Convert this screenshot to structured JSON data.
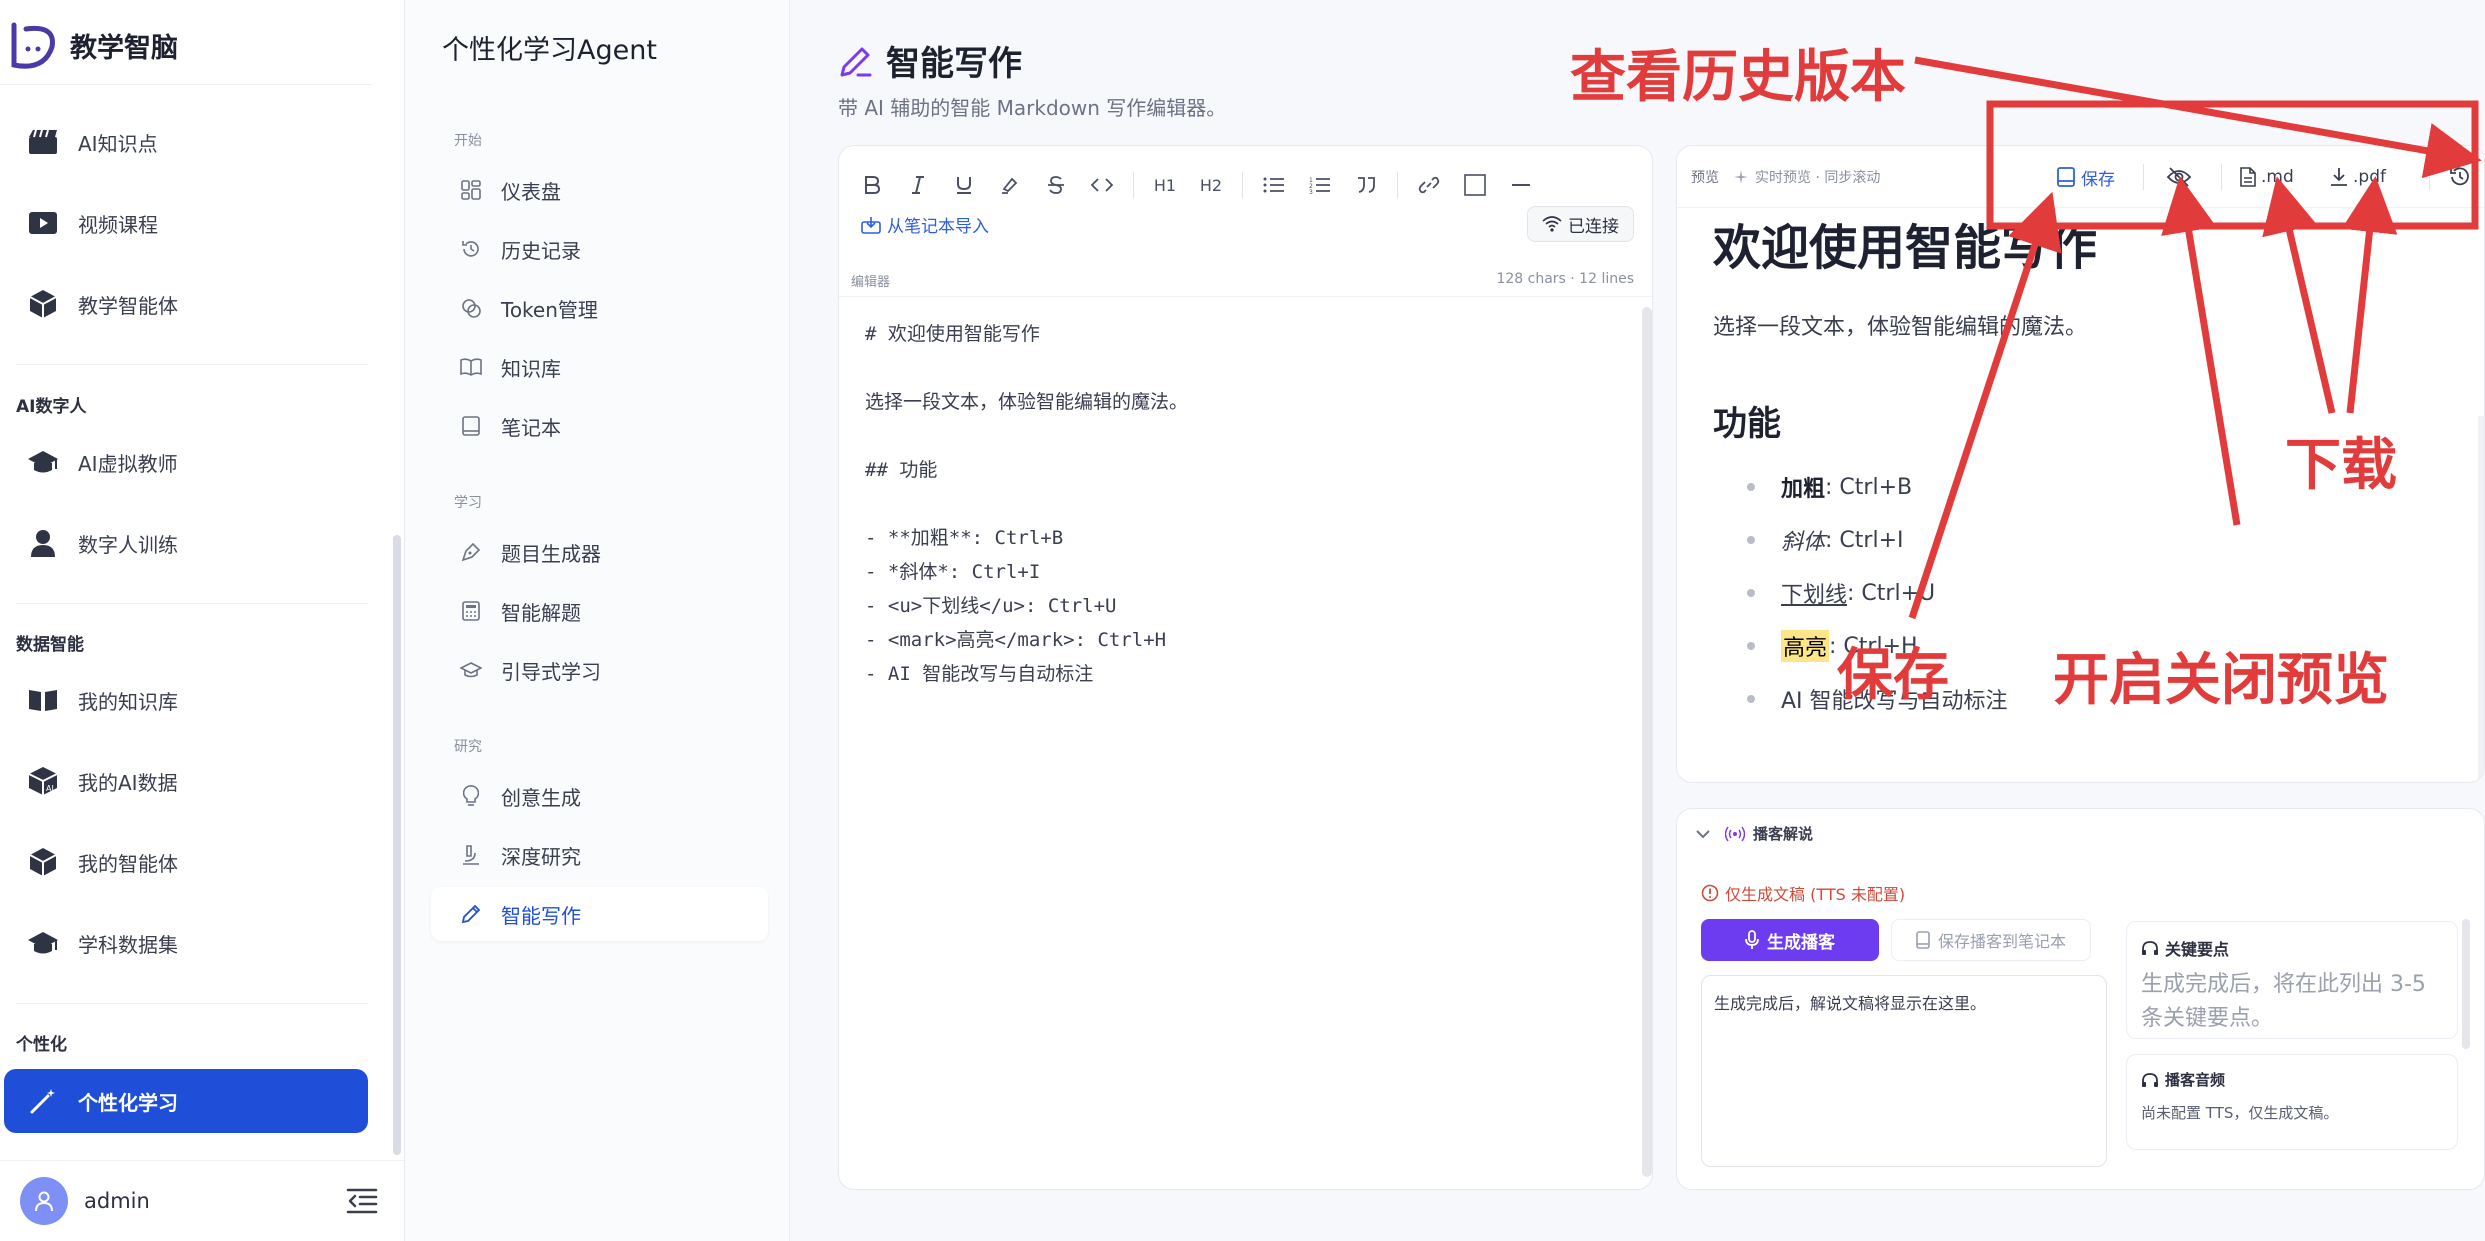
{
  "brand": {
    "name": "教学智脑"
  },
  "sidebar": {
    "items_top": [
      {
        "label": "AI知识点",
        "icon": "clapperboard-icon"
      },
      {
        "label": "视频课程",
        "icon": "video-play-icon"
      },
      {
        "label": "教学智能体",
        "icon": "cube-icon"
      }
    ],
    "group_ai_human": "AI数字人",
    "items_ai_human": [
      {
        "label": "AI虚拟教师",
        "icon": "graduation-cap-icon"
      },
      {
        "label": "数字人训练",
        "icon": "person-icon"
      }
    ],
    "group_data": "数据智能",
    "items_data": [
      {
        "label": "我的知识库",
        "icon": "book-open-icon"
      },
      {
        "label": "我的AI数据",
        "icon": "ai-cube-icon"
      },
      {
        "label": "我的智能体",
        "icon": "cube-icon"
      },
      {
        "label": "学科数据集",
        "icon": "graduation-cap-icon"
      }
    ],
    "group_personal": "个性化",
    "active_item": {
      "label": "个性化学习",
      "icon": "magic-wand-icon"
    },
    "user": {
      "name": "admin"
    }
  },
  "agent_panel": {
    "title": "个性化学习Agent",
    "group_start": "开始",
    "items_start": [
      {
        "label": "仪表盘",
        "icon": "dashboard-icon"
      },
      {
        "label": "历史记录",
        "icon": "history-icon"
      },
      {
        "label": "Token管理",
        "icon": "coins-icon"
      },
      {
        "label": "知识库",
        "icon": "book-icon"
      },
      {
        "label": "笔记本",
        "icon": "notebook-icon"
      }
    ],
    "group_learn": "学习",
    "items_learn": [
      {
        "label": "题目生成器",
        "icon": "pen-tool-icon"
      },
      {
        "label": "智能解题",
        "icon": "calculator-icon"
      },
      {
        "label": "引导式学习",
        "icon": "graduation-cap-icon"
      }
    ],
    "group_research": "研究",
    "items_research": [
      {
        "label": "创意生成",
        "icon": "lightbulb-icon"
      },
      {
        "label": "深度研究",
        "icon": "microscope-icon"
      },
      {
        "label": "智能写作",
        "icon": "pen-icon"
      }
    ]
  },
  "main": {
    "title": "智能写作",
    "subtitle": "带 AI 辅助的智能 Markdown 写作编辑器。"
  },
  "editor": {
    "toolbar": [
      {
        "label": "B",
        "icon": "bold-icon"
      },
      {
        "label": "I",
        "icon": "italic-icon"
      },
      {
        "label": "U",
        "icon": "underline-icon"
      },
      {
        "label": "",
        "icon": "highlighter-icon"
      },
      {
        "label": "S",
        "icon": "strikethrough-icon"
      },
      {
        "label": "",
        "icon": "code-icon"
      },
      {
        "label": "H1",
        "icon": "heading1-icon"
      },
      {
        "label": "H2",
        "icon": "heading2-icon"
      },
      {
        "label": "",
        "icon": "bullet-list-icon"
      },
      {
        "label": "",
        "icon": "ordered-list-icon"
      },
      {
        "label": "",
        "icon": "quote-icon"
      },
      {
        "label": "",
        "icon": "link-icon"
      },
      {
        "label": "",
        "icon": "table-icon"
      },
      {
        "label": "",
        "icon": "horizontal-rule-icon"
      }
    ],
    "import_label": "从笔记本导入",
    "connected_label": "已连接",
    "label": "编辑器",
    "stats": "128 chars · 12 lines",
    "lines": [
      "# 欢迎使用智能写作",
      "",
      "选择一段文本，体验智能编辑的魔法。",
      "",
      "## 功能",
      "",
      "- **加粗**: Ctrl+B",
      "- *斜体*: Ctrl+I",
      "- <u>下划线</u>: Ctrl+U",
      "- <mark>高亮</mark>: Ctrl+H",
      "- AI 智能改写与自动标注"
    ]
  },
  "preview": {
    "label": "预览",
    "live_label": "实时预览 · 同步滚动",
    "save_label": "保存",
    "md_label": ".md",
    "pdf_label": ".pdf",
    "h1": "欢迎使用智能写作",
    "paragraph": "选择一段文本，体验智能编辑的魔法。",
    "h2": "功能",
    "items": [
      {
        "key": "加粗",
        "rest": ": Ctrl+B"
      },
      {
        "key": "斜体",
        "rest": ": Ctrl+I"
      },
      {
        "key": "下划线",
        "rest": ": Ctrl+U"
      },
      {
        "key": "高亮",
        "rest": ": Ctrl+H"
      },
      {
        "key": "",
        "rest": "AI 智能改写与自动标注"
      }
    ]
  },
  "podcast": {
    "title": "播客解说",
    "warning": "仅生成文稿 (TTS 未配置)",
    "generate_label": "生成播客",
    "save_label": "保存播客到笔记本",
    "script_placeholder": "生成完成后，解说文稿将显示在这里。",
    "key_points_title": "关键要点",
    "key_points_text": "生成完成后，将在此列出 3-5 条关键要点。",
    "audio_title": "播客音频",
    "audio_text": "尚未配置 TTS，仅生成文稿。"
  },
  "annotations": {
    "history": "查看历史版本",
    "download": "下载",
    "save": "保存",
    "toggle_preview": "开启关闭预览",
    "color": "#e23b3b"
  }
}
